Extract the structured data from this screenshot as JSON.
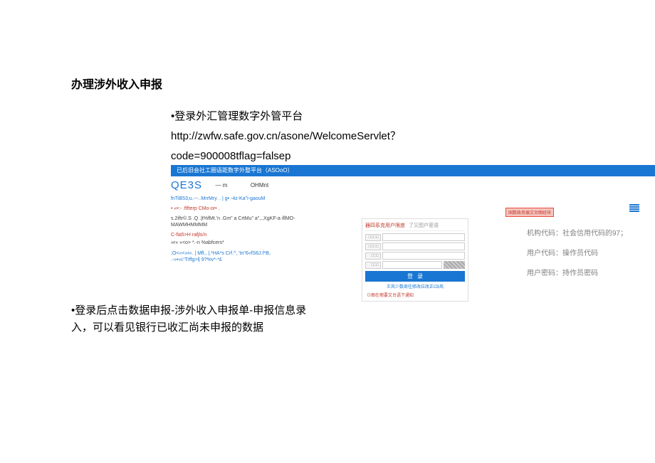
{
  "title": "办理涉外收入申报",
  "step1": {
    "line1": "•登录外汇管理数字外管平台",
    "line2": "http://zwfw.safe.gov.cn/asone/WelcomeServlet？",
    "line3": "code=900008tflag=falsep"
  },
  "blue_bar_text": "已后旧会社工圈语距数字外整平台（ASOoO）",
  "left_block": {
    "qe3s": "QE3S",
    "qe3s_tail1": "— m",
    "qe3s_tail2": "OHMnt",
    "line_blue": "fnTiB53;u.---..MrrMry. . | g• -4z-Ka\"i-gaouM",
    "line_red": "• «•:- .ftfterp CMo-or• .",
    "line_black": "s.2iftr©.S .Q .|t%fMt.'n .Gm\" a CrtMu\" a\",.,XgKF-a iflMO-MAWMHMMMM",
    "line_black2": "C-fia5>H         rafjls/n",
    "line_black3": "»r« »<o> *.-n %abfcers*",
    "line_blue2": ";O<«<»r«. | Mfl., |.*HA*s Crf.^, 'tn\"6«fS6J.f*B, .-»•»i:'Trffg>l| 9?%v*-*£"
  },
  "login_panel": {
    "header_red": "器四系克用户限度",
    "header_gray": "了又图户密语",
    "field1": "□□□□",
    "field2": "□□□□",
    "field3": "□□□",
    "field4": "□□□",
    "button": "登录",
    "footer": "王风少数周往修改应改正CB风",
    "notice": "⊙图在假要文台语下通知"
  },
  "red_badge": "国数政务展文台图经块",
  "annotations": {
    "a1": "机构代码：社会信用代码的97；",
    "a2": "用户代码：操作员代码",
    "a3": "用户密码：持作员密码"
  },
  "step2": "•登录后点击数据申报-涉外收入申报单-申报信息录入，可以看见银行已收汇尚未申报的数据"
}
